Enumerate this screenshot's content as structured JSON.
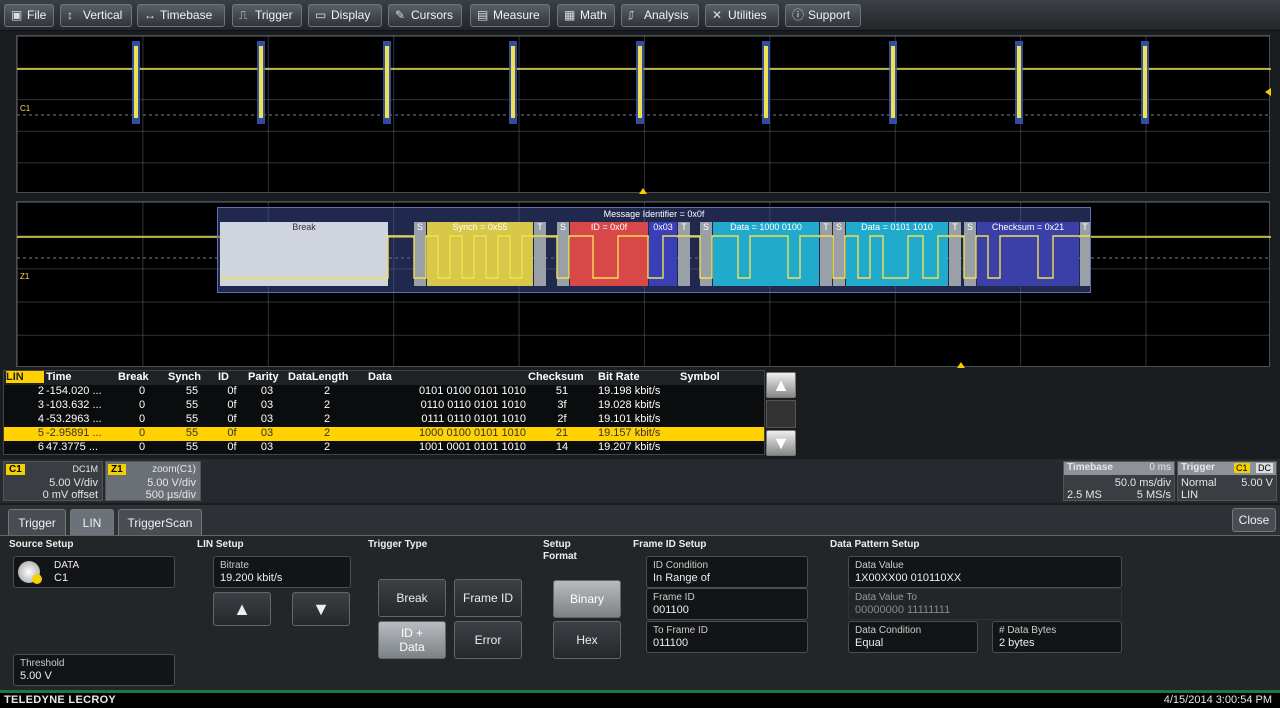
{
  "menu": [
    {
      "label": "File",
      "icon": "file-icon",
      "glyph": "▣"
    },
    {
      "label": "Vertical",
      "icon": "vertical-icon",
      "glyph": "↕"
    },
    {
      "label": "Timebase",
      "icon": "timebase-icon",
      "glyph": "↔"
    },
    {
      "label": "Trigger",
      "icon": "trigger-icon",
      "glyph": "⎍"
    },
    {
      "label": "Display",
      "icon": "display-icon",
      "glyph": "▭"
    },
    {
      "label": "Cursors",
      "icon": "cursors-icon",
      "glyph": "✎"
    },
    {
      "label": "Measure",
      "icon": "measure-icon",
      "glyph": "▤"
    },
    {
      "label": "Math",
      "icon": "math-icon",
      "glyph": "▦"
    },
    {
      "label": "Analysis",
      "icon": "analysis-icon",
      "glyph": "⎎"
    },
    {
      "label": "Utilities",
      "icon": "utilities-icon",
      "glyph": "✕"
    },
    {
      "label": "Support",
      "icon": "support-icon",
      "glyph": "ⓘ"
    }
  ],
  "waveform": {
    "c1_label": "C1",
    "z1_label": "Z1",
    "decode": {
      "title": "Message Identifier = 0x0f",
      "fields": [
        {
          "label": "Break"
        },
        {
          "label": "S"
        },
        {
          "label": "Synch = 0x55"
        },
        {
          "label": "T"
        },
        {
          "label": "S"
        },
        {
          "label": "ID = 0x0f"
        },
        {
          "label": "0x03"
        },
        {
          "label": "T"
        },
        {
          "label": "S"
        },
        {
          "label": "Data = 1000 0100"
        },
        {
          "label": "T"
        },
        {
          "label": "S"
        },
        {
          "label": "Data = 0101 1010"
        },
        {
          "label": "T"
        },
        {
          "label": "S"
        },
        {
          "label": "Checksum = 0x21"
        },
        {
          "label": "T"
        }
      ]
    }
  },
  "table": {
    "headers": [
      "LIN",
      "Time",
      "Break",
      "Synch",
      "ID",
      "Parity",
      "DataLength",
      "Data",
      "Checksum",
      "Bit Rate",
      "Symbol"
    ],
    "rows": [
      [
        "2",
        "-154.020 ...",
        "0",
        "55",
        "0f",
        "03",
        "2",
        "0101 0100 0101 1010",
        "51",
        "19.198 kbit/s",
        ""
      ],
      [
        "3",
        "-103.632 ...",
        "0",
        "55",
        "0f",
        "03",
        "2",
        "0110 0110 0101 1010",
        "3f",
        "19.028 kbit/s",
        ""
      ],
      [
        "4",
        "-53.2963 ...",
        "0",
        "55",
        "0f",
        "03",
        "2",
        "0111 0110 0101 1010",
        "2f",
        "19.101 kbit/s",
        ""
      ],
      [
        "5",
        "-2.95891 ...",
        "0",
        "55",
        "0f",
        "03",
        "2",
        "1000 0100 0101 1010",
        "21",
        "19.157 kbit/s",
        ""
      ],
      [
        "6",
        "47.3775 ...",
        "0",
        "55",
        "0f",
        "03",
        "2",
        "1001 0001 0101 1010",
        "14",
        "19.207 kbit/s",
        ""
      ]
    ],
    "selected_row": 3
  },
  "channels": {
    "c1": {
      "tag": "C1",
      "coupling": "DC1M",
      "vdiv": "5.00 V/div",
      "offset": "0 mV offset"
    },
    "z1": {
      "tag": "Z1",
      "source": "zoom(C1)",
      "vdiv": "5.00 V/div",
      "tdiv": "500 µs/div"
    },
    "timebase": {
      "title": "Timebase",
      "delay": "0 ms",
      "tdiv": "50.0 ms/div",
      "samples": "2.5 MS",
      "rate": "5 MS/s"
    },
    "trigger": {
      "title": "Trigger",
      "src": "C1",
      "coupling": "DC",
      "mode": "Normal",
      "level": "5.00 V",
      "type": "LIN"
    }
  },
  "tabs": [
    {
      "label": "Trigger",
      "active": false
    },
    {
      "label": "LIN",
      "active": true
    },
    {
      "label": "TriggerScan",
      "active": false
    }
  ],
  "close_label": "Close",
  "panel": {
    "source_setup": {
      "title": "Source Setup",
      "data_label": "DATA",
      "data_value": "C1",
      "threshold_label": "Threshold",
      "threshold_value": "5.00 V"
    },
    "lin_setup": {
      "title": "LIN Setup",
      "bitrate_label": "Bitrate",
      "bitrate_value": "19.200 kbit/s"
    },
    "trigger_type": {
      "title": "Trigger Type",
      "break": "Break",
      "frame_id": "Frame ID",
      "id_data_1": "ID +",
      "id_data_2": "Data",
      "error": "Error"
    },
    "setup_format": {
      "title1": "Setup",
      "title2": "Format",
      "binary": "Binary",
      "hex": "Hex"
    },
    "frame_id_setup": {
      "title": "Frame ID Setup",
      "cond_label": "ID Condition",
      "cond_value": "In Range of",
      "fid_label": "Frame ID",
      "fid_value": "001100",
      "tofid_label": "To Frame ID",
      "tofid_value": "011100"
    },
    "data_pattern": {
      "title": "Data Pattern Setup",
      "dv_label": "Data Value",
      "dv_value": "1X00XX00 010110XX",
      "dvt_label": "Data Value To",
      "dvt_value": "00000000 11111111",
      "dc_label": "Data Condition",
      "dc_value": "Equal",
      "nb_label": "# Data Bytes",
      "nb_value": "2 bytes"
    }
  },
  "footer": {
    "brand": "TELEDYNE LECROY",
    "datetime": "4/15/2014 3:00:54 PM"
  },
  "colors": {
    "trace": "#f0e050",
    "highlight": "#ffd200",
    "break": "#d0d4dc",
    "synch": "#d8c84a",
    "id": "#d84848",
    "parity": "#3a3fb8",
    "data": "#22aacc",
    "checksum": "#3a40a8",
    "ts": "#9aa0a8"
  }
}
